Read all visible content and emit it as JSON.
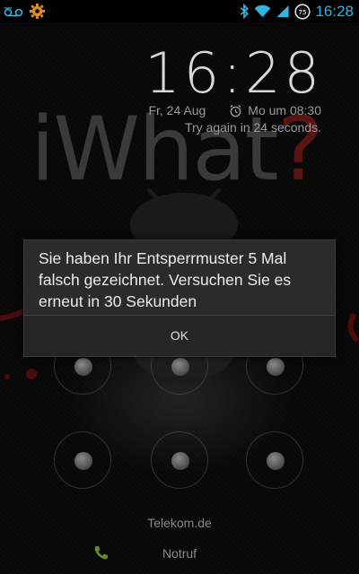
{
  "status_bar": {
    "left_icons": [
      "voicemail-icon",
      "settings-gear-icon"
    ],
    "right_icons": [
      "bluetooth-icon",
      "wifi-icon",
      "cell-signal-icon",
      "battery-icon"
    ],
    "battery_level": "75",
    "time": "16:28",
    "accent_color": "#33b5e5"
  },
  "wallpaper": {
    "logo_text": "iWhat",
    "logo_question": "?"
  },
  "lockscreen": {
    "time": "16:28",
    "date": "Fr, 24 Aug",
    "alarm": "Mo um 08:30",
    "try_again": "Try again in 24 seconds."
  },
  "dialog": {
    "message": "Sie haben Ihr Entsperrmuster 5 Mal falsch gezeichnet. Versuchen Sie es erneut in 30 Sekunden",
    "ok_label": "OK"
  },
  "footer": {
    "carrier": "Telekom.de",
    "emergency_label": "Notruf",
    "emergency_icon": "phone-icon"
  }
}
